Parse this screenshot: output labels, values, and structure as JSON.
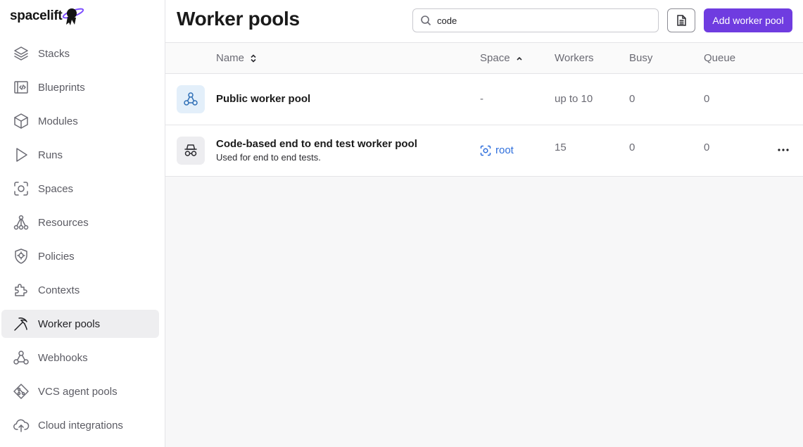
{
  "brand": {
    "name": "spacelift",
    "accent": "#6f3ce0"
  },
  "sidebar": {
    "items": [
      {
        "label": "Stacks",
        "icon": "stacks-icon",
        "active": false
      },
      {
        "label": "Blueprints",
        "icon": "blueprint-icon",
        "active": false
      },
      {
        "label": "Modules",
        "icon": "cube-icon",
        "active": false
      },
      {
        "label": "Runs",
        "icon": "play-icon",
        "active": false
      },
      {
        "label": "Spaces",
        "icon": "spaces-icon",
        "active": false
      },
      {
        "label": "Resources",
        "icon": "resources-icon",
        "active": false
      },
      {
        "label": "Policies",
        "icon": "policy-icon",
        "active": false
      },
      {
        "label": "Contexts",
        "icon": "puzzle-icon",
        "active": false
      },
      {
        "label": "Worker pools",
        "icon": "pickaxe-icon",
        "active": true
      },
      {
        "label": "Webhooks",
        "icon": "webhook-icon",
        "active": false
      },
      {
        "label": "VCS agent pools",
        "icon": "vcs-icon",
        "active": false
      },
      {
        "label": "Cloud integrations",
        "icon": "cloud-upload-icon",
        "active": false
      }
    ]
  },
  "header": {
    "title": "Worker pools",
    "search": {
      "value": "code",
      "placeholder": ""
    },
    "add_label": "Add worker pool"
  },
  "table": {
    "columns": [
      "Name",
      "Space",
      "Workers",
      "Busy",
      "Queue"
    ],
    "rows": [
      {
        "name": "Public worker pool",
        "description": "",
        "space": "-",
        "workers": "up to 10",
        "busy": "0",
        "queue": "0",
        "icon": "public-pool-icon"
      },
      {
        "name": "Code-based end to end test worker pool",
        "description": "Used for end to end tests.",
        "space": "root",
        "workers": "15",
        "busy": "0",
        "queue": "0",
        "icon": "private-pool-icon"
      }
    ]
  }
}
